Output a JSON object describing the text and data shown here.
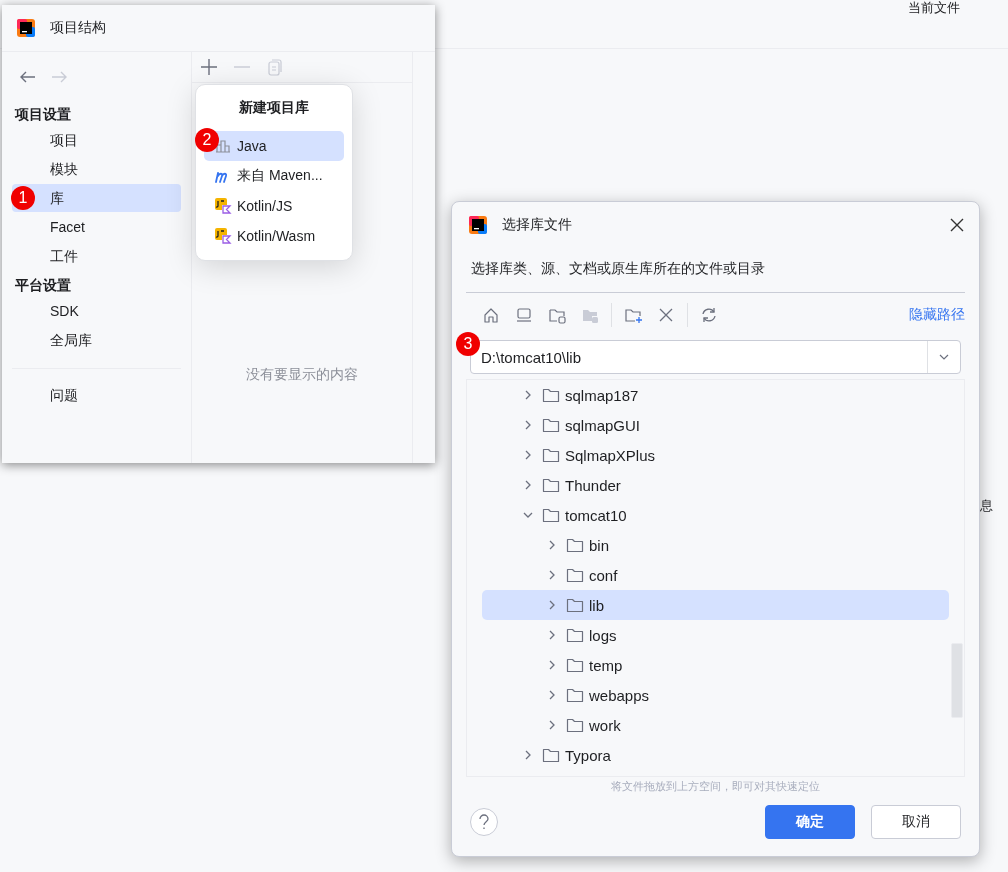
{
  "background_window": {
    "toolbar_text": "当前文件",
    "side_text": "息"
  },
  "project_structure": {
    "title": "项目结构",
    "nav": [
      {
        "kind": "back",
        "disabled": false
      },
      {
        "kind": "forward",
        "disabled": true
      }
    ],
    "toolbar": [
      {
        "kind": "add",
        "disabled": false
      },
      {
        "kind": "remove",
        "disabled": true
      },
      {
        "kind": "copy",
        "disabled": true
      }
    ],
    "sections": [
      {
        "heading": "项目设置",
        "items": [
          {
            "label": "项目",
            "selected": false
          },
          {
            "label": "模块",
            "selected": false
          },
          {
            "label": "库",
            "selected": true,
            "badge": "1"
          },
          {
            "label": "Facet",
            "selected": false
          },
          {
            "label": "工件",
            "selected": false
          }
        ]
      },
      {
        "heading": "平台设置",
        "items": [
          {
            "label": "SDK",
            "selected": false
          },
          {
            "label": "全局库",
            "selected": false
          }
        ]
      }
    ],
    "problems": {
      "label": "问题",
      "selected": false
    },
    "empty_text": "没有要显示的内容"
  },
  "popup": {
    "title": "新建项目库",
    "items": [
      {
        "kind": "java",
        "label": "Java",
        "selected": true,
        "badge": "2"
      },
      {
        "kind": "maven",
        "label": "来自 Maven...",
        "selected": false
      },
      {
        "kind": "kotlin",
        "label": "Kotlin/JS",
        "selected": false
      },
      {
        "kind": "kotlin",
        "label": "Kotlin/Wasm",
        "selected": false
      }
    ]
  },
  "file_dialog": {
    "title": "选择库文件",
    "description": "选择库类、源、文档或原生库所在的文件或目录",
    "toolbar": [
      {
        "kind": "home",
        "disabled": false
      },
      {
        "kind": "desktop",
        "disabled": false
      },
      {
        "kind": "project-folder",
        "disabled": false
      },
      {
        "kind": "module-folder",
        "disabled": true
      },
      {
        "kind": "separator"
      },
      {
        "kind": "new-folder",
        "disabled": false
      },
      {
        "kind": "delete",
        "disabled": false
      },
      {
        "kind": "separator"
      },
      {
        "kind": "refresh",
        "disabled": false
      }
    ],
    "hide_path_link": "隐藏路径",
    "path": {
      "value": "D:\\tomcat10\\lib",
      "badge": "3"
    },
    "tree": [
      {
        "label": "sqlmap187",
        "expanded": false,
        "selected": false
      },
      {
        "label": "sqlmapGUI",
        "expanded": false,
        "selected": false
      },
      {
        "label": "SqlmapXPlus",
        "expanded": false,
        "selected": false
      },
      {
        "label": "Thunder",
        "expanded": false,
        "selected": false
      },
      {
        "label": "tomcat10",
        "expanded": true,
        "selected": false,
        "children": [
          {
            "label": "bin",
            "expanded": false,
            "selected": false
          },
          {
            "label": "conf",
            "expanded": false,
            "selected": false
          },
          {
            "label": "lib",
            "expanded": false,
            "selected": true
          },
          {
            "label": "logs",
            "expanded": false,
            "selected": false
          },
          {
            "label": "temp",
            "expanded": false,
            "selected": false
          },
          {
            "label": "webapps",
            "expanded": false,
            "selected": false
          },
          {
            "label": "work",
            "expanded": false,
            "selected": false
          }
        ]
      },
      {
        "label": "Typora",
        "expanded": false,
        "selected": false
      }
    ],
    "hint": "将文件拖放到上方空间，即可对其快速定位",
    "buttons": [
      {
        "kind": "primary",
        "label": "确定"
      },
      {
        "kind": "secondary",
        "label": "取消"
      }
    ]
  }
}
